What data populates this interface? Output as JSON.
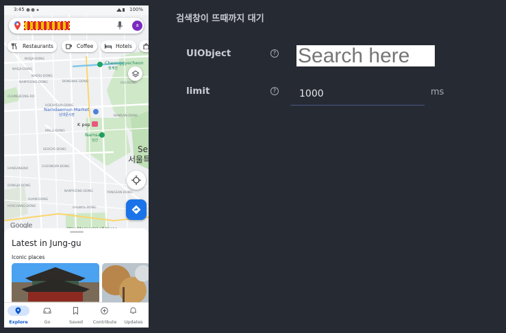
{
  "phone": {
    "status": {
      "time": "3:45",
      "battery": "100%"
    },
    "search": {
      "query": "████████",
      "avatar_letter": "a"
    },
    "chips": [
      {
        "label": "Restaurants",
        "icon": "utensils-icon"
      },
      {
        "label": "Coffee",
        "icon": "coffee-icon"
      },
      {
        "label": "Hotels",
        "icon": "bed-icon"
      }
    ],
    "map": {
      "labels": {
        "cheonggyecheon": "Cheonggyecheon",
        "cheonggyecheon_ko": "청계천",
        "namdaemun": "Namdaemun Market",
        "namdaemun_ko": "남대문시장",
        "kpop": "K pop",
        "namsan": "Namsan",
        "namsan_ko": "남산",
        "seoul_en": "Se",
        "seoul_ko": "서울특",
        "war_memorial": "War Memorial of Korea",
        "google": "Google",
        "districts": [
          "NAEJA-DONG",
          "NAEJA-DONG",
          "NAESU-DONG",
          "NAMYEONG-DONG",
          "BONGNAE-DONG",
          "CHUNGJEONG-RO",
          "MALLI-DONG",
          "SEOGYE-DONG",
          "CHEONGPA-DONG",
          "HANGANGNO",
          "NAMYEONG-DONG",
          "NAMSAN-DONG",
          "HOEHYEON-DONG",
          "DONGJA-DONG",
          "GALWOL-DONG",
          "HUAM-DONG",
          "YONGSAN-DONG",
          "IGU-DONG",
          "HYOCHANG-DONG"
        ]
      }
    },
    "sheet": {
      "title": "Latest in Jung-gu",
      "subtitle": "Iconic places"
    },
    "nav": [
      {
        "label": "Explore",
        "icon": "pin-icon",
        "active": true
      },
      {
        "label": "Go",
        "icon": "car-icon",
        "active": false
      },
      {
        "label": "Saved",
        "icon": "bookmark-icon",
        "active": false
      },
      {
        "label": "Contribute",
        "icon": "plus-circle-icon",
        "active": false
      },
      {
        "label": "Updates",
        "icon": "bell-icon",
        "active": false
      }
    ]
  },
  "step": {
    "title": "검색창이 뜨때까지 대기",
    "uiobject": {
      "label": "UIObject",
      "preview_text": "Search here"
    },
    "limit": {
      "label": "limit",
      "value": "1000",
      "unit": "ms"
    },
    "help_glyph": "?"
  }
}
